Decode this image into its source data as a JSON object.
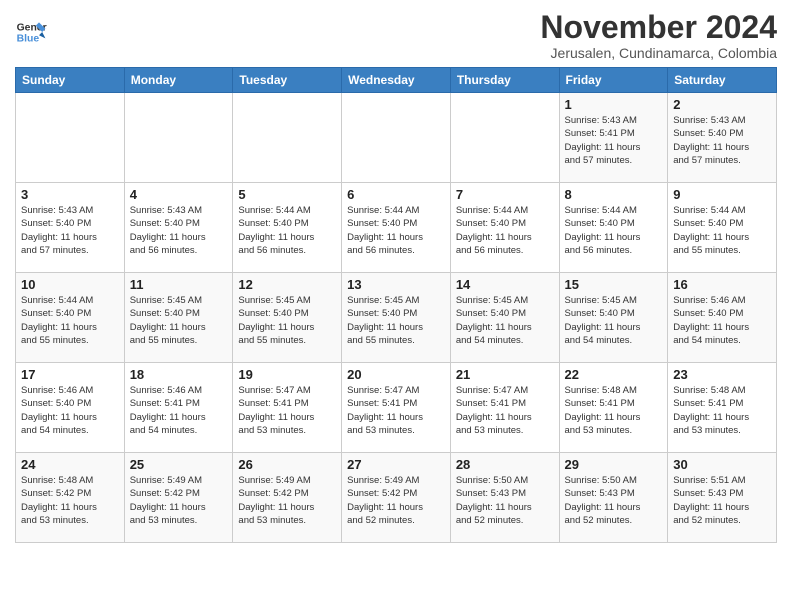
{
  "logo": {
    "line1": "General",
    "line2": "Blue"
  },
  "title": "November 2024",
  "subtitle": "Jerusalen, Cundinamarca, Colombia",
  "days_of_week": [
    "Sunday",
    "Monday",
    "Tuesday",
    "Wednesday",
    "Thursday",
    "Friday",
    "Saturday"
  ],
  "weeks": [
    [
      {
        "day": "",
        "info": ""
      },
      {
        "day": "",
        "info": ""
      },
      {
        "day": "",
        "info": ""
      },
      {
        "day": "",
        "info": ""
      },
      {
        "day": "",
        "info": ""
      },
      {
        "day": "1",
        "info": "Sunrise: 5:43 AM\nSunset: 5:41 PM\nDaylight: 11 hours\nand 57 minutes."
      },
      {
        "day": "2",
        "info": "Sunrise: 5:43 AM\nSunset: 5:40 PM\nDaylight: 11 hours\nand 57 minutes."
      }
    ],
    [
      {
        "day": "3",
        "info": "Sunrise: 5:43 AM\nSunset: 5:40 PM\nDaylight: 11 hours\nand 57 minutes."
      },
      {
        "day": "4",
        "info": "Sunrise: 5:43 AM\nSunset: 5:40 PM\nDaylight: 11 hours\nand 56 minutes."
      },
      {
        "day": "5",
        "info": "Sunrise: 5:44 AM\nSunset: 5:40 PM\nDaylight: 11 hours\nand 56 minutes."
      },
      {
        "day": "6",
        "info": "Sunrise: 5:44 AM\nSunset: 5:40 PM\nDaylight: 11 hours\nand 56 minutes."
      },
      {
        "day": "7",
        "info": "Sunrise: 5:44 AM\nSunset: 5:40 PM\nDaylight: 11 hours\nand 56 minutes."
      },
      {
        "day": "8",
        "info": "Sunrise: 5:44 AM\nSunset: 5:40 PM\nDaylight: 11 hours\nand 56 minutes."
      },
      {
        "day": "9",
        "info": "Sunrise: 5:44 AM\nSunset: 5:40 PM\nDaylight: 11 hours\nand 55 minutes."
      }
    ],
    [
      {
        "day": "10",
        "info": "Sunrise: 5:44 AM\nSunset: 5:40 PM\nDaylight: 11 hours\nand 55 minutes."
      },
      {
        "day": "11",
        "info": "Sunrise: 5:45 AM\nSunset: 5:40 PM\nDaylight: 11 hours\nand 55 minutes."
      },
      {
        "day": "12",
        "info": "Sunrise: 5:45 AM\nSunset: 5:40 PM\nDaylight: 11 hours\nand 55 minutes."
      },
      {
        "day": "13",
        "info": "Sunrise: 5:45 AM\nSunset: 5:40 PM\nDaylight: 11 hours\nand 55 minutes."
      },
      {
        "day": "14",
        "info": "Sunrise: 5:45 AM\nSunset: 5:40 PM\nDaylight: 11 hours\nand 54 minutes."
      },
      {
        "day": "15",
        "info": "Sunrise: 5:45 AM\nSunset: 5:40 PM\nDaylight: 11 hours\nand 54 minutes."
      },
      {
        "day": "16",
        "info": "Sunrise: 5:46 AM\nSunset: 5:40 PM\nDaylight: 11 hours\nand 54 minutes."
      }
    ],
    [
      {
        "day": "17",
        "info": "Sunrise: 5:46 AM\nSunset: 5:40 PM\nDaylight: 11 hours\nand 54 minutes."
      },
      {
        "day": "18",
        "info": "Sunrise: 5:46 AM\nSunset: 5:41 PM\nDaylight: 11 hours\nand 54 minutes."
      },
      {
        "day": "19",
        "info": "Sunrise: 5:47 AM\nSunset: 5:41 PM\nDaylight: 11 hours\nand 53 minutes."
      },
      {
        "day": "20",
        "info": "Sunrise: 5:47 AM\nSunset: 5:41 PM\nDaylight: 11 hours\nand 53 minutes."
      },
      {
        "day": "21",
        "info": "Sunrise: 5:47 AM\nSunset: 5:41 PM\nDaylight: 11 hours\nand 53 minutes."
      },
      {
        "day": "22",
        "info": "Sunrise: 5:48 AM\nSunset: 5:41 PM\nDaylight: 11 hours\nand 53 minutes."
      },
      {
        "day": "23",
        "info": "Sunrise: 5:48 AM\nSunset: 5:41 PM\nDaylight: 11 hours\nand 53 minutes."
      }
    ],
    [
      {
        "day": "24",
        "info": "Sunrise: 5:48 AM\nSunset: 5:42 PM\nDaylight: 11 hours\nand 53 minutes."
      },
      {
        "day": "25",
        "info": "Sunrise: 5:49 AM\nSunset: 5:42 PM\nDaylight: 11 hours\nand 53 minutes."
      },
      {
        "day": "26",
        "info": "Sunrise: 5:49 AM\nSunset: 5:42 PM\nDaylight: 11 hours\nand 53 minutes."
      },
      {
        "day": "27",
        "info": "Sunrise: 5:49 AM\nSunset: 5:42 PM\nDaylight: 11 hours\nand 52 minutes."
      },
      {
        "day": "28",
        "info": "Sunrise: 5:50 AM\nSunset: 5:43 PM\nDaylight: 11 hours\nand 52 minutes."
      },
      {
        "day": "29",
        "info": "Sunrise: 5:50 AM\nSunset: 5:43 PM\nDaylight: 11 hours\nand 52 minutes."
      },
      {
        "day": "30",
        "info": "Sunrise: 5:51 AM\nSunset: 5:43 PM\nDaylight: 11 hours\nand 52 minutes."
      }
    ]
  ]
}
